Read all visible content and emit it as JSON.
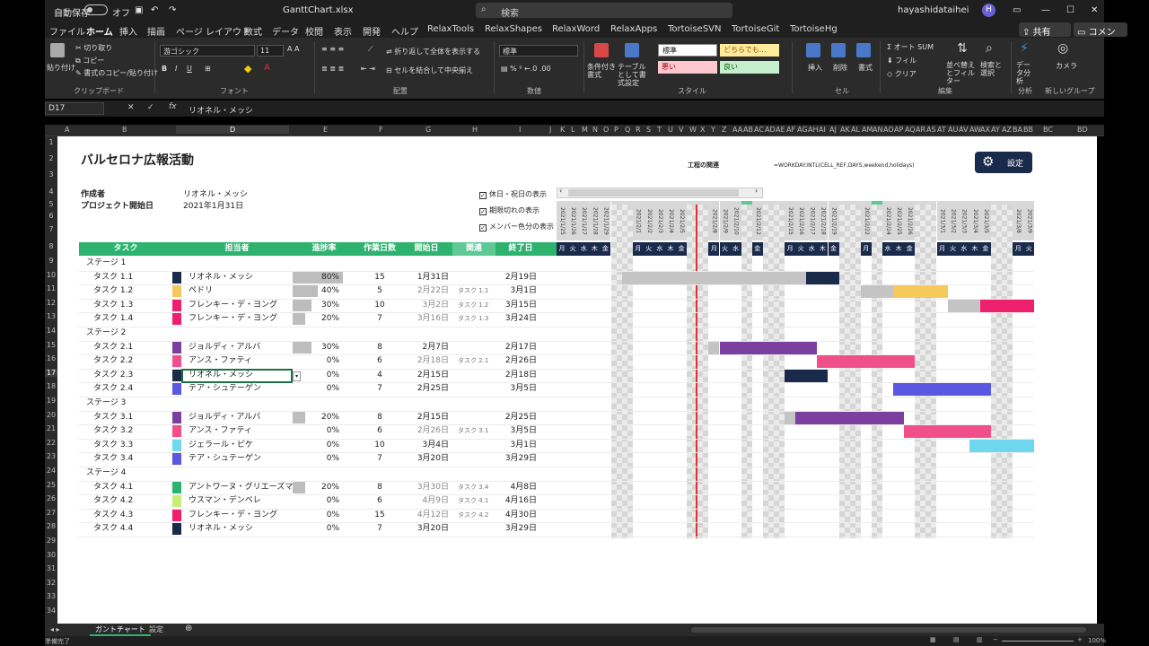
{
  "titlebar": {
    "autosave": "自動保存",
    "autosave_state": "オフ",
    "filename": "GanttChart.xlsx",
    "search": "検索",
    "user": "hayashidataihei",
    "avatar": "H"
  },
  "tabs": [
    "ファイル",
    "ホーム",
    "挿入",
    "描画",
    "ページ レイアウト",
    "数式",
    "データ",
    "校閲",
    "表示",
    "開発",
    "ヘルプ",
    "RelaxTools",
    "RelaxShapes",
    "RelaxWord",
    "RelaxApps",
    "TortoiseSVN",
    "TortoiseGit",
    "TortoiseHg"
  ],
  "share": "共有",
  "comments": "コメント",
  "ribbon": {
    "paste": "貼り付け",
    "cut": "切り取り",
    "copy": "コピー",
    "format_painter": "書式のコピー/貼り付け",
    "font_name": "游ゴシック",
    "font_size": "11",
    "wrap": "折り返して全体を表示する",
    "merge": "セルを結合して中央揃え",
    "number_format": "標準",
    "cond_format": "条件付き書式",
    "table_format": "テーブルとして書式設定",
    "styles": {
      "standard": "標準",
      "neutral": "どちらでも...",
      "bad": "悪い",
      "good": "良い"
    },
    "insert": "挿入",
    "delete": "削除",
    "format": "書式",
    "autosum": "オート SUM",
    "fill": "フィル",
    "clear": "クリア",
    "sort": "並べ替えとフィルター",
    "find": "検索と選択",
    "analyze": "データ分析",
    "camera": "カメラ",
    "groups": {
      "clipboard": "クリップボード",
      "font": "フォント",
      "align": "配置",
      "number": "数値",
      "style": "スタイル",
      "cells": "セル",
      "edit": "編集",
      "analysis": "分析",
      "new_group": "新しいグループ"
    }
  },
  "formula": {
    "namebox": "D17",
    "value": "リオネル・メッシ"
  },
  "columns": [
    "A",
    "B",
    "C",
    "D",
    "E",
    "F",
    "G",
    "H",
    "I",
    "J",
    "K",
    "L",
    "M",
    "N",
    "O",
    "P",
    "Q",
    "R",
    "S",
    "T",
    "U",
    "V",
    "W",
    "X",
    "Y",
    "Z",
    "AA",
    "AB",
    "AC",
    "AD",
    "AE",
    "AF",
    "AG",
    "AH",
    "AI",
    "AJ",
    "AK",
    "AL",
    "AM",
    "AN",
    "AO",
    "AP",
    "AQ",
    "AR",
    "AS",
    "AT",
    "AU",
    "AV",
    "AW",
    "AX",
    "AY",
    "AZ",
    "BA",
    "BB",
    "BC",
    "BD"
  ],
  "sheet": {
    "title": "バルセロナ広報活動",
    "author_label": "作成者",
    "author": "リオネル・メッシ",
    "start_label": "プロジェクト開始日",
    "start": "2021年1月31日",
    "rel_label": "工程の関連",
    "rel_formula": "=WORKDAY.INTL(CELL_REF,DAYS,weekend,holidays)",
    "settings": "設定",
    "checks": [
      "休日・祝日の表示",
      "期限切れの表示",
      "メンバー色分の表示"
    ],
    "headers": {
      "task": "タスク",
      "owner": "担当者",
      "progress": "進捗率",
      "days": "作業日数",
      "startd": "開始日",
      "rel": "関連",
      "end": "終了日"
    },
    "weekdays": [
      "月",
      "火",
      "水",
      "木",
      "金",
      "土",
      "日"
    ]
  },
  "rows": [
    {
      "stage": "ステージ 1"
    },
    {
      "task": "タスク 1.1",
      "owner": "リオネル・メッシ",
      "color": "#1a2a4a",
      "p": "80%",
      "pv": 0.8,
      "days": "15",
      "start": "1月31日",
      "rel": "",
      "end": "2月19日"
    },
    {
      "task": "タスク 1.2",
      "owner": "ペドリ",
      "color": "#f7c85a",
      "p": "40%",
      "pv": 0.4,
      "days": "5",
      "start": "2月22日",
      "rel": "タスク 1.1",
      "end": "3月1日"
    },
    {
      "task": "タスク 1.3",
      "owner": "フレンキー・デ・ヨング",
      "color": "#ee1f6c",
      "p": "30%",
      "pv": 0.3,
      "days": "10",
      "start": "3月2日",
      "rel": "タスク 1.2",
      "end": "3月15日"
    },
    {
      "task": "タスク 1.4",
      "owner": "フレンキー・デ・ヨング",
      "color": "#ee1f6c",
      "p": "20%",
      "pv": 0.2,
      "days": "7",
      "start": "3月16日",
      "rel": "タスク 1.3",
      "end": "3月24日"
    },
    {
      "stage": "ステージ 2"
    },
    {
      "task": "タスク 2.1",
      "owner": "ジョルディ・アルバ",
      "color": "#7b3fa0",
      "p": "30%",
      "pv": 0.3,
      "days": "8",
      "start": "2月7日",
      "rel": "",
      "end": "2月17日"
    },
    {
      "task": "タスク 2.2",
      "owner": "アンス・ファティ",
      "color": "#f04f8a",
      "p": "0%",
      "pv": 0,
      "days": "6",
      "start": "2月18日",
      "rel": "タスク 2.1",
      "end": "2月26日"
    },
    {
      "task": "タスク 2.3",
      "owner": "リオネル・メッシ",
      "color": "#1a2a4a",
      "p": "0%",
      "pv": 0,
      "days": "4",
      "start": "2月15日",
      "rel": "",
      "end": "2月18日"
    },
    {
      "task": "タスク 2.4",
      "owner": "テア・シュテーゲン",
      "color": "#5a57e0",
      "p": "0%",
      "pv": 0,
      "days": "7",
      "start": "2月25日",
      "rel": "",
      "end": "3月5日"
    },
    {
      "stage": "ステージ 3"
    },
    {
      "task": "タスク 3.1",
      "owner": "ジョルディ・アルバ",
      "color": "#7b3fa0",
      "p": "20%",
      "pv": 0.2,
      "days": "8",
      "start": "2月15日",
      "rel": "",
      "end": "2月25日"
    },
    {
      "task": "タスク 3.2",
      "owner": "アンス・ファティ",
      "color": "#f04f8a",
      "p": "0%",
      "pv": 0,
      "days": "6",
      "start": "2月26日",
      "rel": "タスク 3.1",
      "end": "3月5日"
    },
    {
      "task": "タスク 3.3",
      "owner": "ジェラール・ピケ",
      "color": "#6fd8ef",
      "p": "0%",
      "pv": 0,
      "days": "10",
      "start": "3月4日",
      "rel": "",
      "end": "3月1日"
    },
    {
      "task": "タスク 3.4",
      "owner": "テア・シュテーゲン",
      "color": "#5a57e0",
      "p": "0%",
      "pv": 0,
      "days": "7",
      "start": "3月20日",
      "rel": "",
      "end": "3月29日"
    },
    {
      "stage": "ステージ 4"
    },
    {
      "task": "タスク 4.1",
      "owner": "アントワーヌ・グリエーズマン",
      "color": "#2db36f",
      "p": "20%",
      "pv": 0.2,
      "days": "8",
      "start": "3月30日",
      "rel": "タスク 3.4",
      "end": "4月8日"
    },
    {
      "task": "タスク 4.2",
      "owner": "ウスマン・デンベレ",
      "color": "#c8ee7a",
      "p": "0%",
      "pv": 0,
      "days": "6",
      "start": "4月9日",
      "rel": "タスク 4.1",
      "end": "4月16日"
    },
    {
      "task": "タスク 4.3",
      "owner": "フレンキー・デ・ヨング",
      "color": "#ee1f6c",
      "p": "0%",
      "pv": 0,
      "days": "15",
      "start": "4月12日",
      "rel": "タスク 4.2",
      "end": "4月30日"
    },
    {
      "task": "タスク 4.4",
      "owner": "リオネル・メッシ",
      "color": "#1a2a4a",
      "p": "0%",
      "pv": 0,
      "days": "7",
      "start": "3月20日",
      "rel": "",
      "end": "3月29日"
    }
  ],
  "gantt_dates": [
    "2021/1/25",
    "2021/1/26",
    "2021/1/27",
    "2021/1/28",
    "2021/1/29",
    "2021/1/30",
    "2021/1/31",
    "2021/2/1",
    "2021/2/2",
    "2021/2/3",
    "2021/2/4",
    "2021/2/5",
    "2021/2/6",
    "2021/2/7",
    "2021/2/8",
    "2021/2/9",
    "2021/2/10",
    "2021/2/11",
    "2021/2/12",
    "2021/2/13",
    "2021/2/14",
    "2021/2/15",
    "2021/2/16",
    "2021/2/17",
    "2021/2/18",
    "2021/2/19",
    "2021/2/20",
    "2021/2/21",
    "2021/2/22",
    "2021/2/23",
    "2021/2/24",
    "2021/2/25",
    "2021/2/26",
    "2021/2/27",
    "2021/2/28",
    "2021/3/1",
    "2021/3/2",
    "2021/3/3",
    "2021/3/4",
    "2021/3/5",
    "2021/3/6",
    "2021/3/7",
    "2021/3/8",
    "2021/3/9"
  ],
  "gantt_bars": [
    {
      "row": 1,
      "start": 6,
      "len": 17,
      "color": "#c4c4c4"
    },
    {
      "row": 1,
      "start": 23,
      "len": 3,
      "color": "#1a2a4a"
    },
    {
      "row": 2,
      "start": 28,
      "len": 3,
      "color": "#c4c4c4"
    },
    {
      "row": 2,
      "start": 31,
      "len": 5,
      "color": "#f7c85a"
    },
    {
      "row": 3,
      "start": 36,
      "len": 3,
      "color": "#c4c4c4"
    },
    {
      "row": 3,
      "start": 39,
      "len": 5,
      "color": "#ee1f6c"
    },
    {
      "row": 6,
      "start": 14,
      "len": 1,
      "color": "#c4c4c4"
    },
    {
      "row": 6,
      "start": 15,
      "len": 9,
      "color": "#7b3fa0"
    },
    {
      "row": 7,
      "start": 24,
      "len": 9,
      "color": "#f04f8a"
    },
    {
      "row": 8,
      "start": 21,
      "len": 4,
      "color": "#1a2a4a"
    },
    {
      "row": 9,
      "start": 31,
      "len": 9,
      "color": "#5a57e0"
    },
    {
      "row": 11,
      "start": 21,
      "len": 1,
      "color": "#c4c4c4"
    },
    {
      "row": 11,
      "start": 22,
      "len": 10,
      "color": "#7b3fa0"
    },
    {
      "row": 12,
      "start": 32,
      "len": 8,
      "color": "#f04f8a"
    },
    {
      "row": 13,
      "start": 38,
      "len": 6,
      "color": "#6fd8ef"
    }
  ],
  "bottom": {
    "tab1": "ガントチャート",
    "tab2": "設定",
    "status": "準備完了",
    "zoom": "100%"
  }
}
